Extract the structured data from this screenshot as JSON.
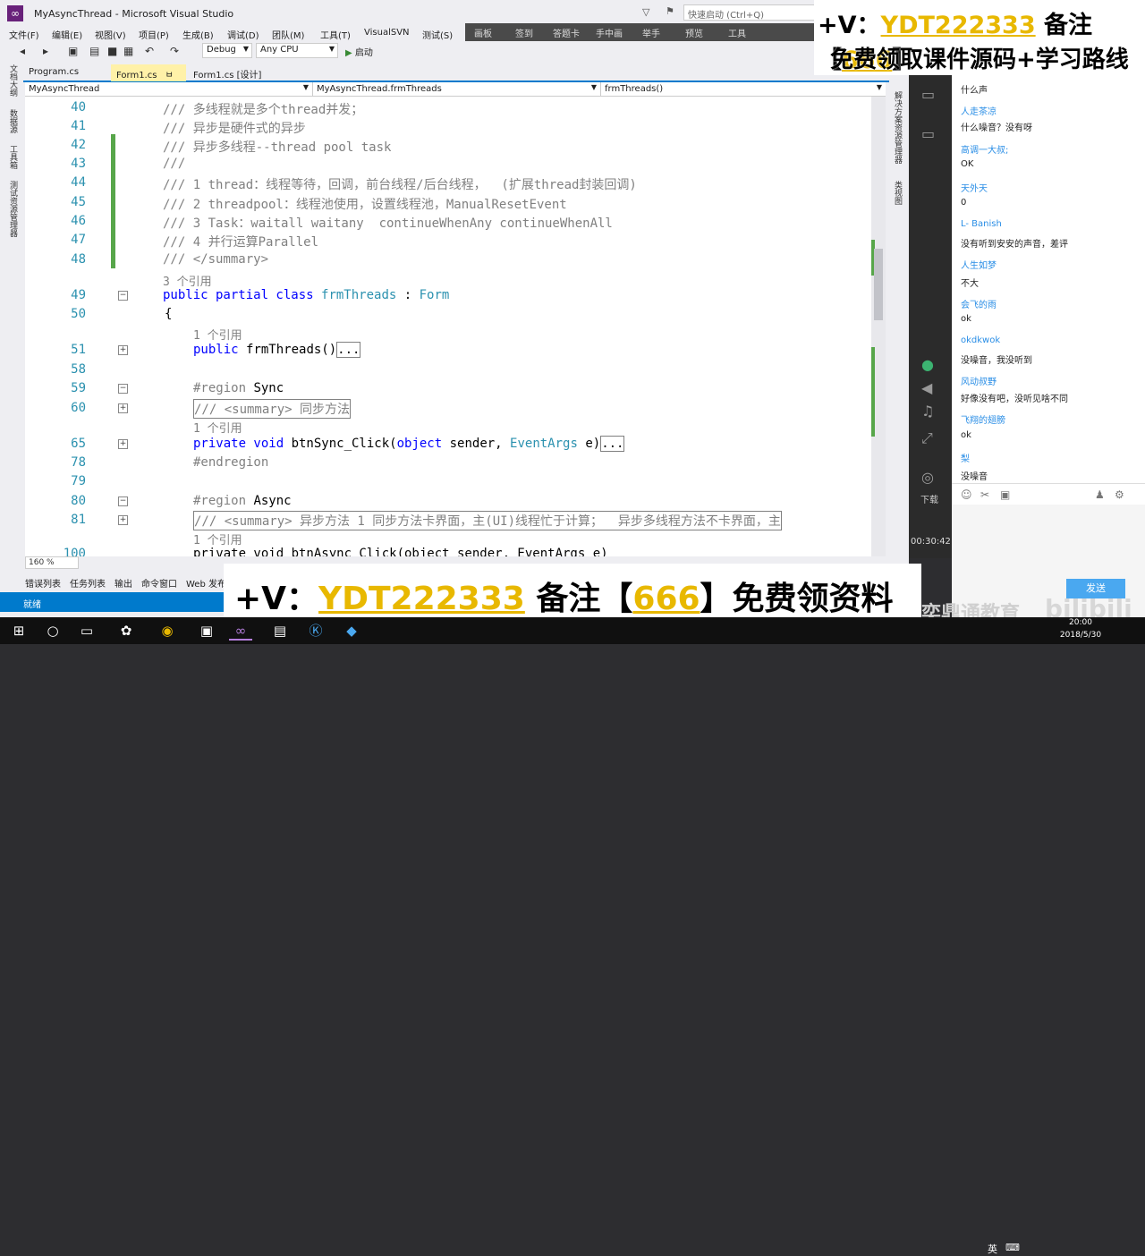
{
  "window": {
    "title": "MyAsyncThread - Microsoft Visual Studio",
    "quick_launch": "快速启动 (Ctrl+Q)"
  },
  "menu": [
    "文件(F)",
    "编辑(E)",
    "视图(V)",
    "项目(P)",
    "生成(B)",
    "调试(D)",
    "团队(M)",
    "工具(T)",
    "VisualSVN",
    "测试(S)"
  ],
  "overlay_toolbar": [
    "画板",
    "签到",
    "答题卡",
    "手中画",
    "举手",
    "预览",
    "工具"
  ],
  "toolbar": {
    "config": "Debug",
    "platform": "Any CPU",
    "start": "启动"
  },
  "left_tabs": [
    "文档大纲",
    "数据源",
    "工具箱",
    "测试资源管理器"
  ],
  "right_tabs": [
    "解决方案资源管理器",
    "类视图"
  ],
  "doc_tabs": [
    {
      "label": "Program.cs",
      "active": false
    },
    {
      "label": "Form1.cs",
      "active": true
    },
    {
      "label": "Form1.cs [设计]",
      "active": false
    }
  ],
  "navbar": {
    "project": "MyAsyncThread",
    "class": "MyAsyncThread.frmThreads",
    "member": "frmThreads()"
  },
  "code_lines": [
    {
      "n": "40",
      "text": "/// 多线程就是多个thread并发；"
    },
    {
      "n": "41",
      "text": "/// 异步是硬件式的异步"
    },
    {
      "n": "42",
      "text": "/// 异步多线程--thread pool task"
    },
    {
      "n": "43",
      "text": "///"
    },
    {
      "n": "44",
      "text": "/// 1 thread：线程等待，回调，前台线程/后台线程，  (扩展thread封装回调)"
    },
    {
      "n": "45",
      "text": "/// 2 threadpool：线程池使用，设置线程池，ManualResetEvent"
    },
    {
      "n": "46",
      "text": "/// 3 Task：waitall waitany  continueWhenAny continueWhenAll"
    },
    {
      "n": "47",
      "text": "/// 4 并行运算Parallel"
    },
    {
      "n": "48",
      "text": "/// </summary>"
    }
  ],
  "code_more": {
    "ref3": "3 个引用",
    "l49_n": "49",
    "l49_kw": "public partial class ",
    "l49_name": "frmThreads",
    "l49_sep": " : ",
    "l49_base": "Form",
    "l50_n": "50",
    "l50_text": "{",
    "ref1a": "1 个引用",
    "l51_n": "51",
    "l51_kw": "public ",
    "l51_name": "frmThreads()",
    "l51_box": "...",
    "l58_n": "58",
    "l59_n": "59",
    "l59_kw": "#region ",
    "l59_name": "Sync",
    "l60_n": "60",
    "l60_text": "/// <summary> 同步方法",
    "ref1b": "1 个引用",
    "l65_n": "65",
    "l65_kw": "private void ",
    "l65_name": "btnSync_Click(",
    "l65_p1": "object",
    "l65_p2": " sender, ",
    "l65_p3": "EventArgs",
    "l65_p4": " e)",
    "l65_box": "...",
    "l78_n": "78",
    "l78_text": "#endregion",
    "l79_n": "79",
    "l80_n": "80",
    "l80_kw": "#region ",
    "l80_name": "Async",
    "l81_n": "81",
    "l81_text": "/// <summary> 异步方法 1 同步方法卡界面，主(UI)线程忙于计算；  异步多线程方法不卡界面，主",
    "ref1c": "1 个引用",
    "l100_n": "100",
    "l100_text": "private void btnAsync_Click(object sender, EventArgs e)"
  },
  "zoom": "160 %",
  "bottom_tabs": [
    "错误列表",
    "任务列表",
    "输出",
    "命令窗口",
    "Web 发布"
  ],
  "status": "就绪",
  "live": {
    "time": "00:30:42",
    "download": "下载"
  },
  "chat": [
    {
      "user": "",
      "text": "什么声"
    },
    {
      "user": "人走茶凉",
      "text": "什么噪音？没有呀"
    },
    {
      "user": "高调一大叔;",
      "text": "OK"
    },
    {
      "user": "天外天",
      "text": "0"
    },
    {
      "user": "L- Banish",
      "text": "没有听到安安的声音，差评"
    },
    {
      "user": "人生如梦",
      "text": "不大"
    },
    {
      "user": "会飞的雨",
      "text": "ok"
    },
    {
      "user": "okdkwok",
      "text": "没噪音，我没听到"
    },
    {
      "user": "风动叔野",
      "text": "好像没有吧，没听见啥不同"
    },
    {
      "user": "飞翔的翅膀",
      "text": "ok"
    },
    {
      "user": "梨",
      "text": "没噪音"
    }
  ],
  "send": "发送",
  "ad": {
    "top_prefix": "+V：",
    "top_id": "YDT222333",
    "top_mid": " 备注【",
    "top_code": "666",
    "top_end": "】",
    "top_line2": "免费领取课件源码+学习路线",
    "bottom_prefix": "+V：",
    "bottom_id": "YDT222333",
    "bottom_mid": " 备注【",
    "bottom_code": "666",
    "bottom_end": "】免费领资料"
  },
  "brand": "奕鼎通教育",
  "bili": "bilibili",
  "taskbar": {
    "lang": "英",
    "time": "20:00",
    "date": "2018/5/30"
  }
}
